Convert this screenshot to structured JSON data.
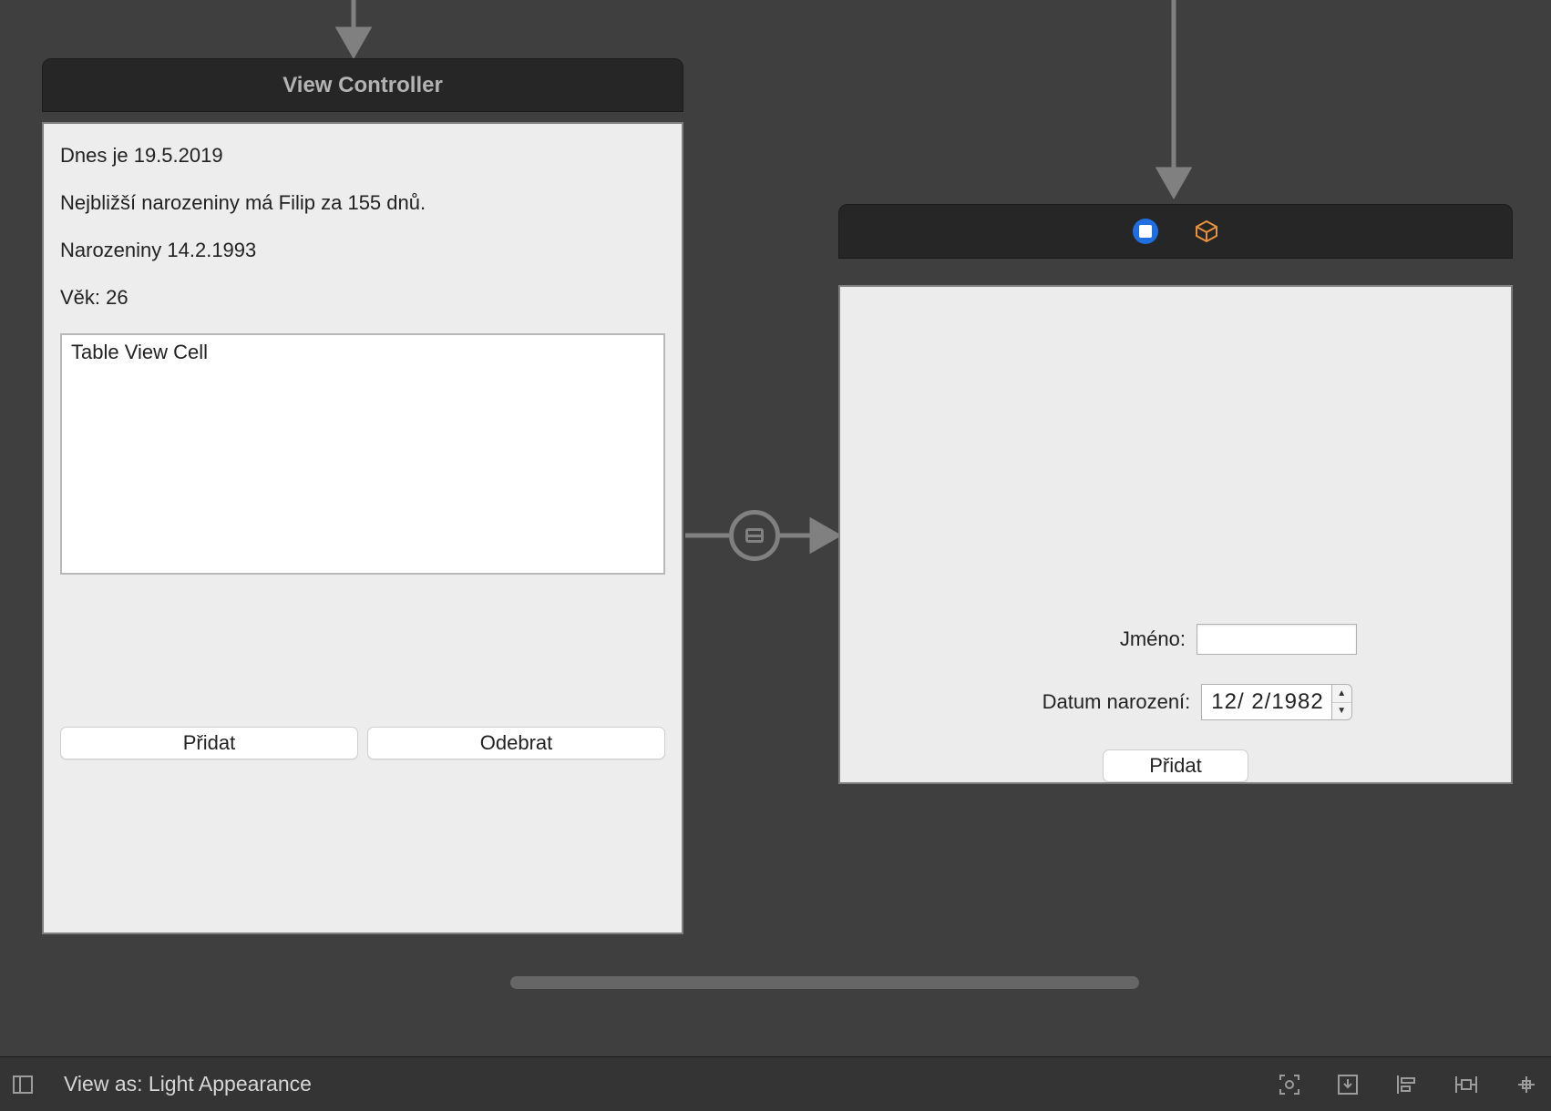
{
  "left_scene": {
    "title": "View Controller",
    "today_line": "Dnes je 19.5.2019",
    "closest_line": "Nejbližší narozeniny má Filip za 155 dnů.",
    "birthday_line": "Narozeniny 14.2.1993",
    "age_line": "Věk: 26",
    "table_cell_label": "Table View Cell",
    "add_button": "Přidat",
    "remove_button": "Odebrat"
  },
  "right_scene": {
    "name_label": "Jméno:",
    "name_value": "",
    "dob_label": "Datum narození:",
    "dob_value": "12/  2/1982",
    "add_button": "Přidat"
  },
  "bottom_bar": {
    "view_as": "View as: Light Appearance"
  }
}
